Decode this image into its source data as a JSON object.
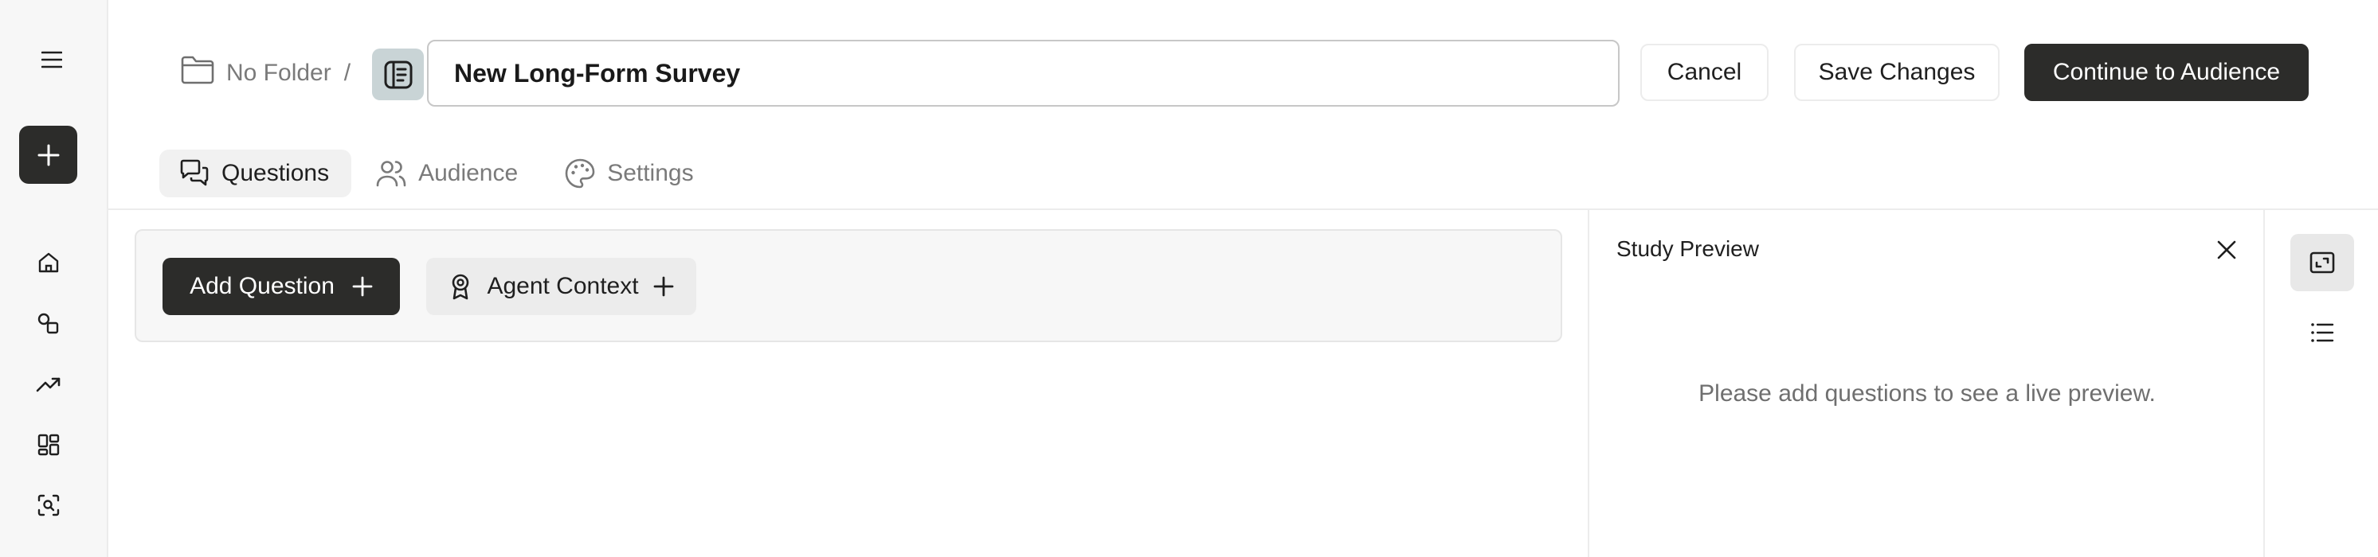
{
  "sidebar": {
    "menu_icon": "hamburger-menu-icon",
    "new_icon": "plus-icon",
    "nav_icons": [
      "home-icon",
      "shapes-icon",
      "trending-icon",
      "dashboard-icon",
      "scan-search-icon"
    ]
  },
  "header": {
    "folder_label": "No Folder",
    "separator": "/",
    "survey_title": "New Long-Form Survey",
    "cancel_label": "Cancel",
    "save_label": "Save Changes",
    "continue_label": "Continue to Audience"
  },
  "tabs": [
    {
      "label": "Questions",
      "icon": "chat-bubbles-icon",
      "active": true
    },
    {
      "label": "Audience",
      "icon": "users-icon",
      "active": false
    },
    {
      "label": "Settings",
      "icon": "palette-icon",
      "active": false
    }
  ],
  "question_panel": {
    "add_question_label": "Add Question",
    "agent_context_label": "Agent Context"
  },
  "preview": {
    "title": "Study Preview",
    "empty_message": "Please add questions to see a live preview."
  },
  "colors": {
    "primary": "#2c2c2a",
    "doc_icon_bg": "#c9d4d6",
    "muted_text": "#7a7a7a"
  }
}
